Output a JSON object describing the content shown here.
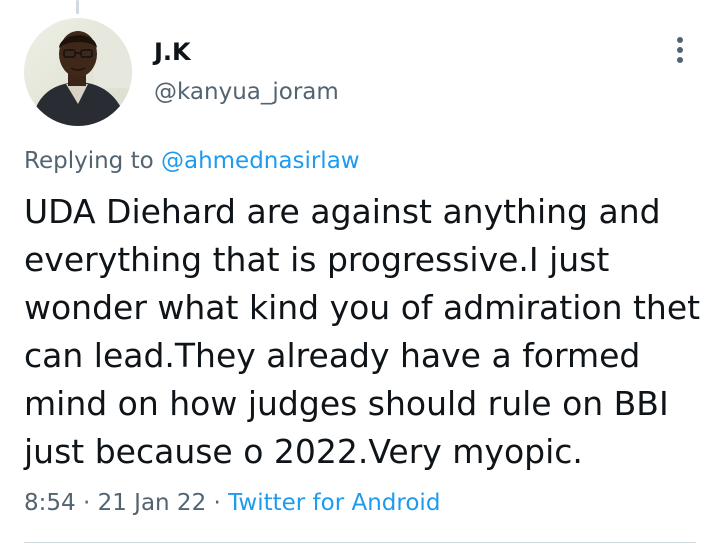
{
  "author": {
    "display_name": "J.K",
    "handle": "@kanyua_joram"
  },
  "reply": {
    "prefix": "Replying to",
    "mention": "@ahmednasirlaw"
  },
  "tweet": {
    "lines": [
      "UDA Diehard are against anything and",
      "everything that is progressive.I just",
      "wonder what kind you of admiration thet",
      "can lead.They already have a formed",
      "mind on how judges should rule on BBI",
      "just because o 2022.Very myopic."
    ]
  },
  "meta": {
    "time": "8:54",
    "separator": "·",
    "date": "21 Jan 22",
    "source": "Twitter for Android"
  },
  "icons": {
    "more": "more-vertical-icon"
  },
  "colors": {
    "accent": "#1d9bf0",
    "secondary_text": "#536471",
    "primary_text": "#0f1419"
  }
}
